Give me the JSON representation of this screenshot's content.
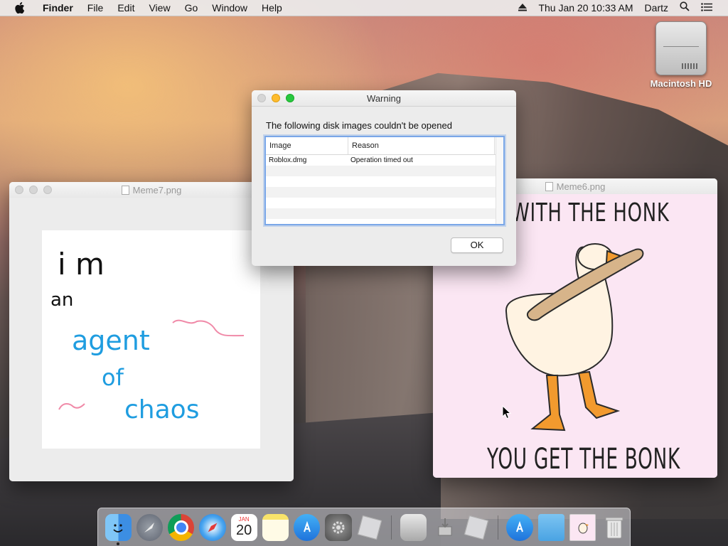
{
  "menubar": {
    "app_name": "Finder",
    "items": [
      "File",
      "Edit",
      "View",
      "Go",
      "Window",
      "Help"
    ],
    "clock": "Thu Jan 20  10:33 AM",
    "user": "Dartz"
  },
  "desktop": {
    "hd_label": "Macintosh HD"
  },
  "meme6": {
    "title": "Meme6.png",
    "top_text": "S WITH THE HONK",
    "bottom_text": "YOU GET THE BONK"
  },
  "meme7": {
    "title": "Meme7.png",
    "handwriting": [
      "i m",
      "an",
      "agent",
      "of",
      "chaos"
    ]
  },
  "warning": {
    "title": "Warning",
    "message": "The following disk images couldn't be opened",
    "columns": [
      "Image",
      "Reason"
    ],
    "rows": [
      {
        "image": "Roblox.dmg",
        "reason": "Operation timed out"
      }
    ],
    "ok_label": "OK"
  },
  "dock": {
    "calendar_month": "JAN",
    "calendar_day": "20",
    "items": [
      "finder-icon",
      "launchpad-icon",
      "chrome-icon",
      "safari-icon",
      "calendar-icon",
      "notes-icon",
      "app-store-icon",
      "system-preferences-icon",
      "roblox-icon",
      "disk-utility-icon",
      "installer-icon",
      "roblox-studio-icon",
      "app-store-downloads-icon",
      "folder-icon",
      "meme-preview-icon",
      "trash-icon"
    ]
  },
  "colors": {
    "menubar_bg": "#ececec",
    "selection_blue": "#7aa7e8",
    "meme6_bg": "#fbe6f3"
  }
}
